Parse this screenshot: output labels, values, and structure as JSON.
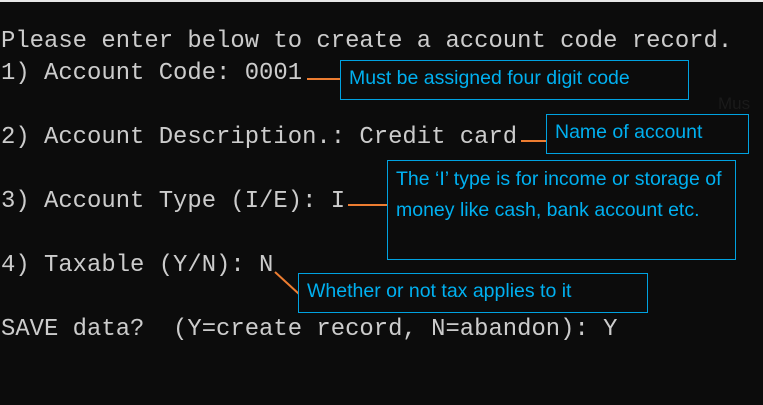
{
  "terminal": {
    "lines": [
      "Please enter below to create a account code record.",
      "1) Account Code: 0001",
      "2) Account Description.: Credit card",
      "3) Account Type (I/E): I",
      "4) Taxable (Y/N): N",
      "SAVE data?  (Y=create record, N=abandon): Y"
    ]
  },
  "callouts": {
    "code": "Must be assigned four digit code",
    "description": "Name of account",
    "type": "The ‘I’ type is for income or storage of money like cash, bank account etc.",
    "taxable": "Whether or not tax applies to it"
  },
  "stray_text": "Mus",
  "colors": {
    "background": "#0c0c0c",
    "text": "#cccccc",
    "callout": "#00b0f0",
    "connector": "#ed7d31"
  }
}
